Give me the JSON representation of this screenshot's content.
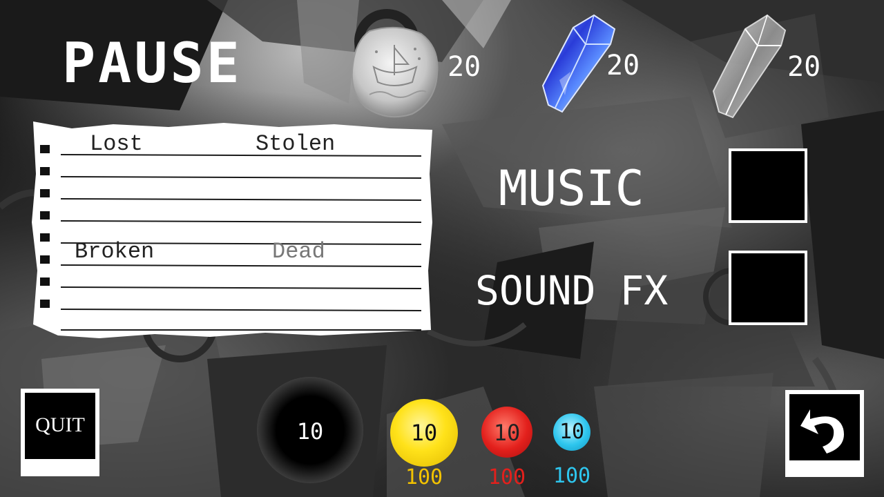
{
  "screen": {
    "title": "PAUSE"
  },
  "currencies": [
    {
      "icon": "silver-coin-icon",
      "count": "20"
    },
    {
      "icon": "blue-crystal-icon",
      "count": "20"
    },
    {
      "icon": "clear-crystal-icon",
      "count": "20"
    }
  ],
  "stats_note": {
    "labels": {
      "lost": "Lost",
      "stolen": "Stolen",
      "broken": "Broken",
      "dead": "Dead"
    }
  },
  "settings": {
    "music_label": "MUSIC",
    "music_enabled": false,
    "sound_label": "SOUND FX",
    "sound_enabled": false
  },
  "buttons": {
    "quit_label": "QUIT",
    "back_icon": "undo-arrow-icon"
  },
  "resources": {
    "black_orb": {
      "value": "10",
      "color": "#000000"
    },
    "yellow": {
      "value": "10",
      "max": "100",
      "color": "#ffe21a"
    },
    "red": {
      "value": "10",
      "max": "100",
      "color": "#e3201c"
    },
    "cyan": {
      "value": "10",
      "max": "100",
      "color": "#2ec6ee"
    }
  }
}
